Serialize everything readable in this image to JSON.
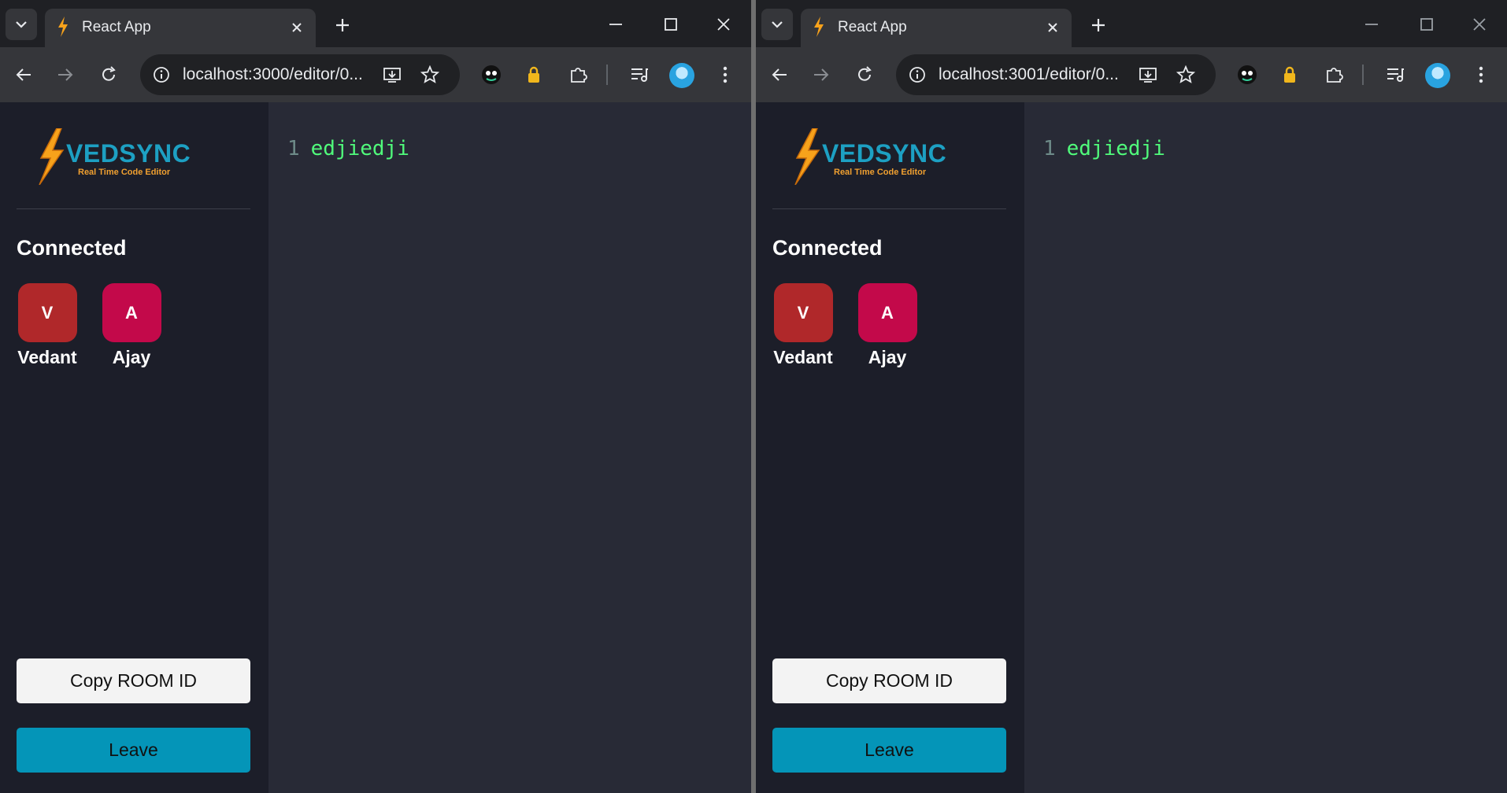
{
  "windows": [
    {
      "tab": {
        "title": "React App"
      },
      "url": "localhost:3000/editor/0...",
      "logo": {
        "word": "VEDSYNC",
        "tagline": "Real Time Code Editor"
      },
      "sidebar": {
        "connected_title": "Connected",
        "clients": [
          {
            "initial": "V",
            "name": "Vedant",
            "color": "#b0282a"
          },
          {
            "initial": "A",
            "name": "Ajay",
            "color": "#c3094a"
          }
        ],
        "copy_label": "Copy ROOM ID",
        "leave_label": "Leave"
      },
      "editor": {
        "lines": [
          {
            "number": "1",
            "text": "edjiedji"
          }
        ]
      }
    },
    {
      "tab": {
        "title": "React App"
      },
      "url": "localhost:3001/editor/0...",
      "logo": {
        "word": "VEDSYNC",
        "tagline": "Real Time Code Editor"
      },
      "sidebar": {
        "connected_title": "Connected",
        "clients": [
          {
            "initial": "V",
            "name": "Vedant",
            "color": "#b0282a"
          },
          {
            "initial": "A",
            "name": "Ajay",
            "color": "#c3094a"
          }
        ],
        "copy_label": "Copy ROOM ID",
        "leave_label": "Leave"
      },
      "editor": {
        "lines": [
          {
            "number": "1",
            "text": "edjiedji"
          }
        ]
      }
    }
  ],
  "colors": {
    "accent": "#0495b8",
    "logo_blue": "#1da0c3",
    "logo_orange": "#f0a030",
    "code_green": "#50fa7b"
  },
  "icons": [
    "tab-search-icon",
    "bolt-favicon-icon",
    "close-icon",
    "plus-icon",
    "minimize-icon",
    "maximize-icon",
    "back-icon",
    "forward-icon",
    "reload-icon",
    "info-icon",
    "install-icon",
    "star-icon",
    "extension-icon",
    "lock-extension-icon",
    "puzzle-icon",
    "media-icon",
    "profile-avatar",
    "kebab-menu-icon"
  ]
}
